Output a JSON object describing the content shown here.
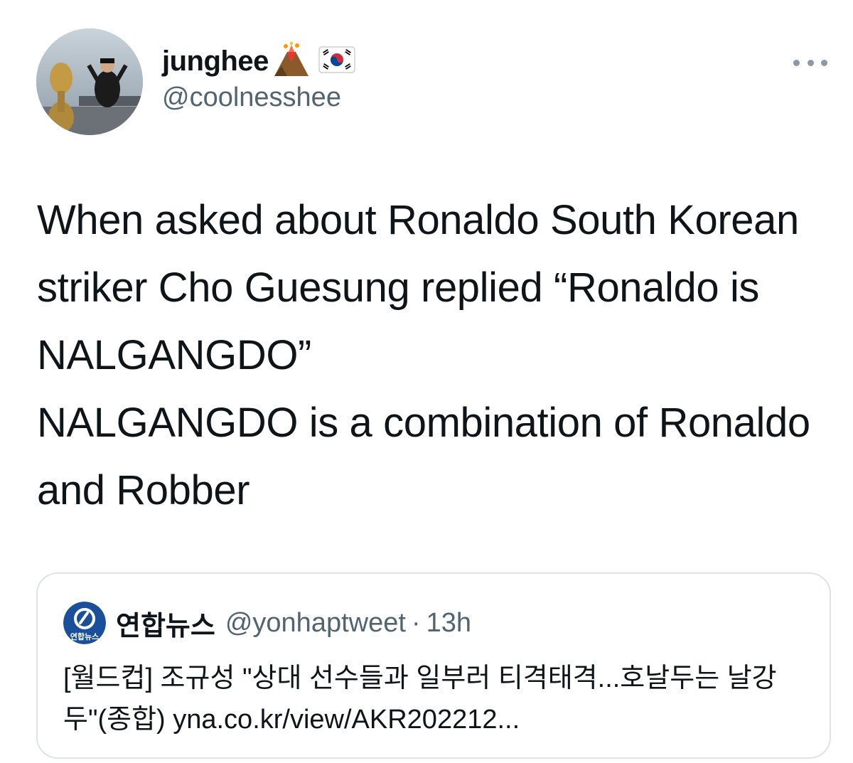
{
  "author": {
    "display_name": "junghee",
    "emojis": [
      "volcano-emoji",
      "south-korea-flag-emoji"
    ],
    "handle": "@coolnesshee"
  },
  "tweet": {
    "paragraph_1": "When asked about Ronaldo South Korean striker Cho Guesung replied “Ronaldo is NALGANGDO”",
    "paragraph_2": "NALGANGDO is a combination of Ronaldo and Robber"
  },
  "quote": {
    "display_name": "연합뉴스",
    "handle": "@yonhaptweet",
    "separator": "·",
    "time": "13h",
    "avatar_label": "연합뉴스",
    "text": "[월드컵] 조규성 \"상대 선수들과 일부러 티격태격...호날두는 날강두\"(종합) yna.co.kr/view/AKR202212..."
  },
  "colors": {
    "text_primary": "#0f1419",
    "text_secondary": "#536471",
    "border": "#dfe3e6",
    "brand_blue": "#1a4f9c"
  }
}
